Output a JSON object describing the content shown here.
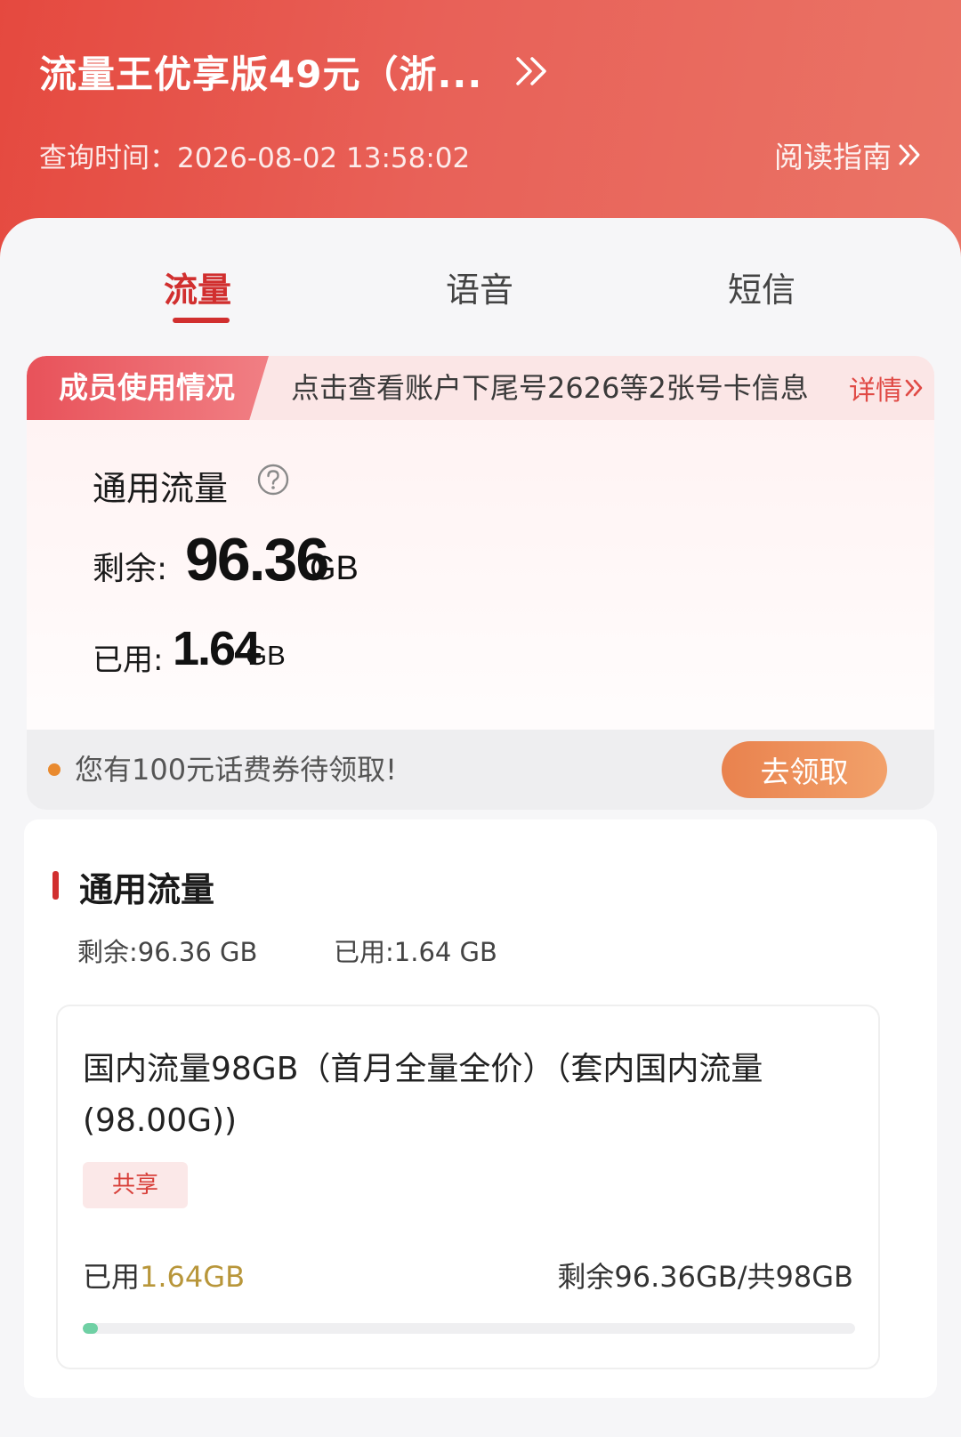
{
  "header": {
    "plan_name": "流量王优享版49元（浙...",
    "query_time": "查询时间：2026-08-02 13:58:02",
    "guide_label": "阅读指南",
    "gradient_colors": [
      "#e5493f",
      "#ea7466"
    ]
  },
  "tabs": [
    {
      "label": "流量",
      "active": true
    },
    {
      "label": "语音",
      "active": false
    },
    {
      "label": "短信",
      "active": false
    }
  ],
  "member": {
    "tag": "成员使用情况",
    "info": "点击查看账户下尾号2626等2张号卡信息",
    "detail_label": "详情"
  },
  "overview": {
    "title": "通用流量",
    "help_icon": "question-circle-icon",
    "remain_label": "剩余:",
    "remain_value": "96.36",
    "remain_unit": "GB",
    "used_label": "已用:",
    "used_value": "1.64",
    "used_unit": "GB"
  },
  "coupon": {
    "text": "您有100元话费券待领取!",
    "button": "去领取"
  },
  "detail": {
    "title": "通用流量",
    "summary_remain": "剩余:96.36 GB",
    "summary_used": "已用:1.64 GB",
    "package": {
      "name": "国内流量98GB（首月全量全价）（套内国内流量(98.00G))",
      "badge": "共享",
      "used_label": "已用",
      "used_value": "1.64GB",
      "remain_text": "剩余96.36GB/共98GB",
      "used_fraction": 0.0167
    }
  },
  "colors": {
    "accent": "#d12f2f",
    "coupon_button": "#ee9058",
    "progress": "#6fd0a4",
    "used_highlight": "#b8963a"
  }
}
